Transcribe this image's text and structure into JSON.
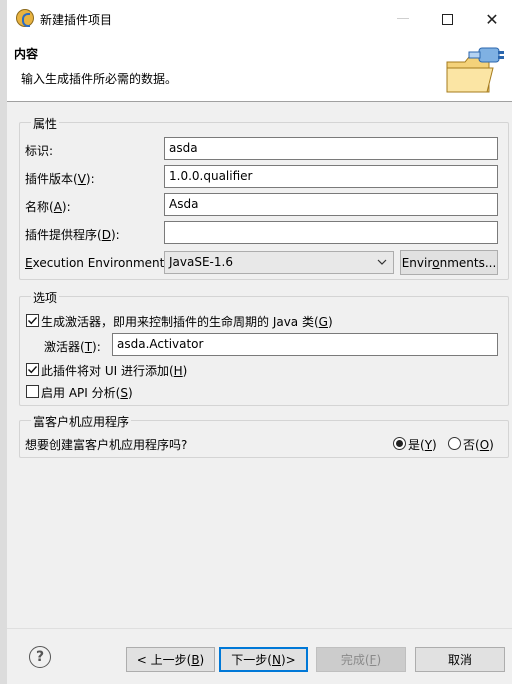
{
  "window": {
    "title": "新建插件项目",
    "close_glyph": "✕"
  },
  "banner": {
    "title": "内容",
    "description": "输入生成插件所必需的数据。"
  },
  "properties": {
    "group_label": "属性",
    "id_label": "标识",
    "id_label_suffix": ":",
    "id_value": "asda",
    "version_label": "插件版本",
    "version_mnemonic": "V",
    "version_value": "1.0.0.qualifier",
    "name_label": "名称",
    "name_mnemonic": "A",
    "name_value": "Asda",
    "provider_label": "插件提供程序",
    "provider_mnemonic": "D",
    "provider_value": "",
    "env_label_pre": "",
    "env_label_mnemonic": "E",
    "env_label_post": "xecution Environment:",
    "env_value": "JavaSE-1.6",
    "env_button_pre": "Envir",
    "env_button_mnemonic": "o",
    "env_button_post": "nments..."
  },
  "options": {
    "group_label": "选项",
    "gen_activator_label": "生成激活器，即用来控制插件的生命周期的 Java 类",
    "gen_activator_mnemonic": "G",
    "gen_activator_checked": true,
    "activator_label": "激活器",
    "activator_mnemonic": "T",
    "activator_value": "asda.Activator",
    "ui_contrib_label": "此插件将对 UI 进行添加",
    "ui_contrib_mnemonic": "H",
    "ui_contrib_checked": true,
    "api_label": "启用 API 分析",
    "api_mnemonic": "S",
    "api_checked": false
  },
  "rcp": {
    "group_label": "富客户机应用程序",
    "question": "想要创建富客户机应用程序吗?",
    "yes_label": "是",
    "yes_mnemonic": "Y",
    "no_label": "否",
    "no_mnemonic": "O",
    "selected": "yes"
  },
  "footer": {
    "help_glyph": "?",
    "back_label": "< 上一步",
    "back_mnemonic": "B",
    "next_label": "下一步",
    "next_mnemonic": "N",
    "next_suffix": " >",
    "finish_label": "完成",
    "finish_mnemonic": "F",
    "cancel_label": "取消"
  },
  "colors": {
    "focus_border": "#0078d7",
    "window_bg": "#f0f0f0",
    "banner_bg": "#ffffff"
  }
}
